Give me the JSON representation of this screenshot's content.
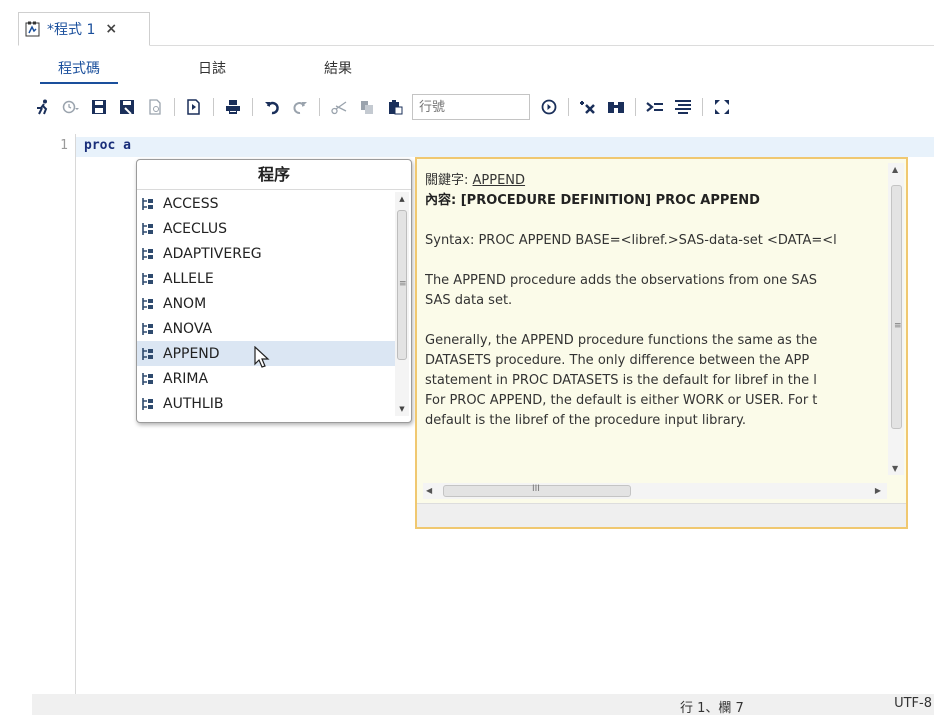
{
  "doc_tab": {
    "title": "*程式 1",
    "close": "×"
  },
  "subtabs": [
    "程式碼",
    "日誌",
    "結果"
  ],
  "toolbar": {
    "line_placeholder": "行號"
  },
  "editor": {
    "line_number": "1",
    "code": "proc a"
  },
  "autocomplete": {
    "header": "程序",
    "items": [
      "ACCESS",
      "ACECLUS",
      "ADAPTIVEREG",
      "ALLELE",
      "ANOM",
      "ANOVA",
      "APPEND",
      "ARIMA",
      "AUTHLIB"
    ],
    "selected_index": 6
  },
  "help": {
    "keyword_label": "關鍵字: ",
    "keyword_value": "APPEND",
    "content_title": "內容: [PROCEDURE DEFINITION] PROC APPEND",
    "syntax": "Syntax: PROC APPEND BASE=<libref.>SAS-data-set <DATA=<l",
    "para1_line1": "The APPEND procedure adds the observations from one SAS",
    "para1_line2": "SAS data set.",
    "para2_line1": "Generally, the APPEND procedure functions the same as the",
    "para2_line2": "DATASETS procedure. The only difference between the APP",
    "para2_line3": "statement in PROC DATASETS is the default for libref in the l",
    "para2_line4": "For PROC APPEND, the default is either WORK or USER. For t",
    "para2_line5": "default is the libref of the procedure input library.",
    "hscroll_grip": "III"
  },
  "status": {
    "position": "行 1、欄 7",
    "encoding": "UTF-8"
  },
  "colors": {
    "accent": "#1a4f9c",
    "help_bg": "#fbfbe9",
    "help_border": "#f0c870",
    "selection": "#dbe6f3"
  }
}
